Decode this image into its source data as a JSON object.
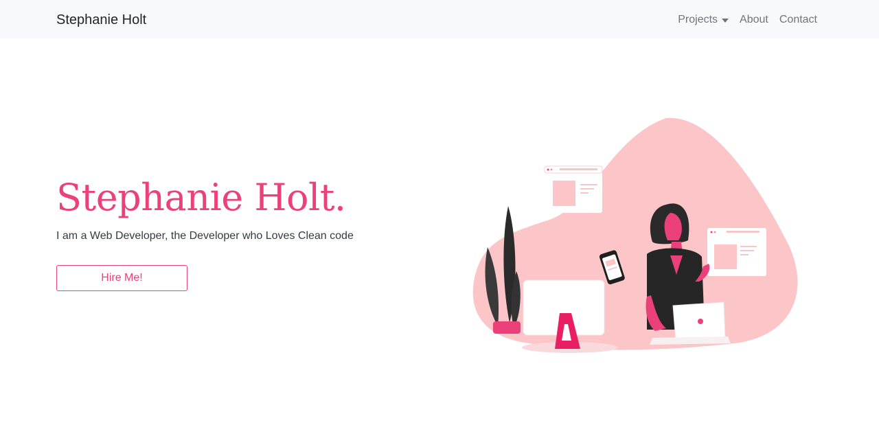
{
  "navbar": {
    "brand": "Stephanie Holt",
    "links": {
      "projects": "Projects",
      "about": "About",
      "contact": "Contact"
    }
  },
  "hero": {
    "title": "Stephanie Holt.",
    "subtitle": "I am a Web Developer, the Developer who Loves Clean code",
    "cta_label": "Hire Me!"
  },
  "colors": {
    "accent": "#ec407a",
    "navbar_bg": "#f8f9fa",
    "blob": "#fcc5c8",
    "text": "#343a40"
  },
  "icons": {
    "projects_dropdown": "caret-down-icon"
  }
}
